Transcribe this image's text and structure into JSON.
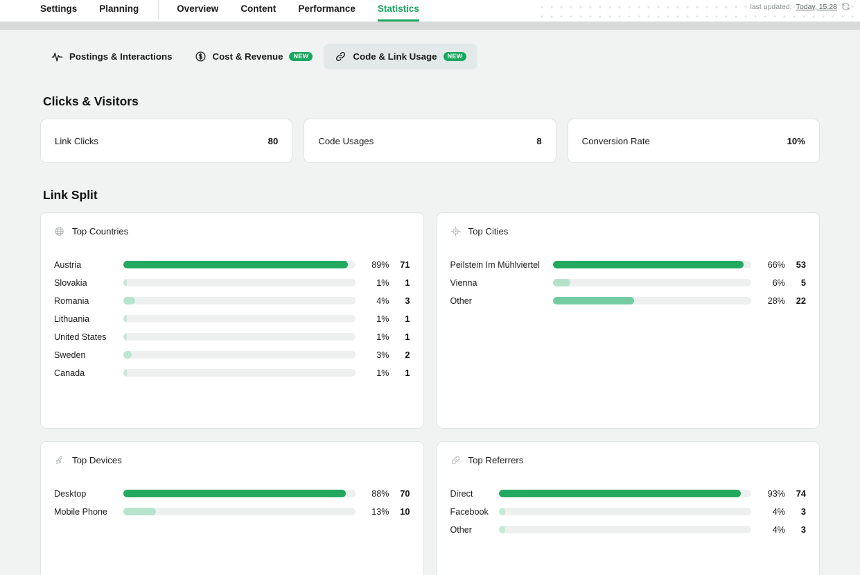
{
  "topnav": {
    "left_items": [
      {
        "label": "Settings",
        "active": false
      },
      {
        "label": "Planning",
        "active": false
      }
    ],
    "right_items": [
      {
        "label": "Overview",
        "active": false
      },
      {
        "label": "Content",
        "active": false
      },
      {
        "label": "Performance",
        "active": false
      },
      {
        "label": "Statistics",
        "active": true
      }
    ],
    "last_updated_label": "last updated:",
    "last_updated_value": "Today, 15:28",
    "refresh_icon": "refresh-icon",
    "active_color": "#1aa75d"
  },
  "subtabs": [
    {
      "label": "Postings & Interactions",
      "icon": "activity-pulse-icon",
      "badge": null,
      "active": false
    },
    {
      "label": "Cost & Revenue",
      "icon": "dollar-circle-icon",
      "badge": "NEW",
      "active": false
    },
    {
      "label": "Code & Link Usage",
      "icon": "link-chain-icon",
      "badge": "NEW",
      "active": true
    }
  ],
  "clicks_visitors": {
    "title": "Clicks & Visitors",
    "cards": [
      {
        "label": "Link Clicks",
        "value": "80"
      },
      {
        "label": "Code Usages",
        "value": "8"
      },
      {
        "label": "Conversion Rate",
        "value": "10%"
      }
    ]
  },
  "link_split": {
    "title": "Link Split",
    "panels": [
      {
        "title": "Top Countries",
        "icon": "globe-icon",
        "rows": [
          {
            "label": "Austria",
            "pct": "89%",
            "count": "71",
            "fill": 97,
            "color": "#22a95f"
          },
          {
            "label": "Slovakia",
            "pct": "1%",
            "count": "1",
            "fill": 1.5,
            "color": "#c5e9d6"
          },
          {
            "label": "Romania",
            "pct": "4%",
            "count": "3",
            "fill": 5,
            "color": "#b7e4cd"
          },
          {
            "label": "Lithuania",
            "pct": "1%",
            "count": "1",
            "fill": 1.5,
            "color": "#c5e9d6"
          },
          {
            "label": "United States",
            "pct": "1%",
            "count": "1",
            "fill": 1.5,
            "color": "#c5e9d6"
          },
          {
            "label": "Sweden",
            "pct": "3%",
            "count": "2",
            "fill": 3.5,
            "color": "#bbe6d0"
          },
          {
            "label": "Canada",
            "pct": "1%",
            "count": "1",
            "fill": 1.5,
            "color": "#c5e9d6"
          }
        ]
      },
      {
        "title": "Top Cities",
        "icon": "location-target-icon",
        "rows": [
          {
            "label": "Peilstein Im Mühlviertel",
            "pct": "66%",
            "count": "53",
            "fill": 96,
            "color": "#22a95f"
          },
          {
            "label": "Vienna",
            "pct": "6%",
            "count": "5",
            "fill": 9,
            "color": "#b3e2c9"
          },
          {
            "label": "Other",
            "pct": "28%",
            "count": "22",
            "fill": 41,
            "color": "#73cca1"
          }
        ]
      },
      {
        "title": "Top Devices",
        "icon": "rocket-icon",
        "rows": [
          {
            "label": "Desktop",
            "pct": "88%",
            "count": "70",
            "fill": 96,
            "color": "#22a95f"
          },
          {
            "label": "Mobile Phone",
            "pct": "13%",
            "count": "10",
            "fill": 14,
            "color": "#b7e4cd"
          }
        ]
      },
      {
        "title": "Top Referrers",
        "icon": "link-chain-icon",
        "rows": [
          {
            "label": "Direct",
            "pct": "93%",
            "count": "74",
            "fill": 96,
            "color": "#22a95f"
          },
          {
            "label": "Facebook",
            "pct": "4%",
            "count": "3",
            "fill": 2.5,
            "color": "#c5e9d6"
          },
          {
            "label": "Other",
            "pct": "4%",
            "count": "3",
            "fill": 2.5,
            "color": "#c5e9d6"
          }
        ]
      }
    ]
  },
  "colors": {
    "accent_green": "#1aa75d",
    "bar_green": "#22a95f",
    "bar_green_mid": "#73cca1",
    "bar_green_light": "#c5e9d6",
    "bar_track": "#eef0ef",
    "page_bg": "#f1f2f2",
    "card_bg": "#ffffff",
    "card_border": "#e1e4e4"
  }
}
